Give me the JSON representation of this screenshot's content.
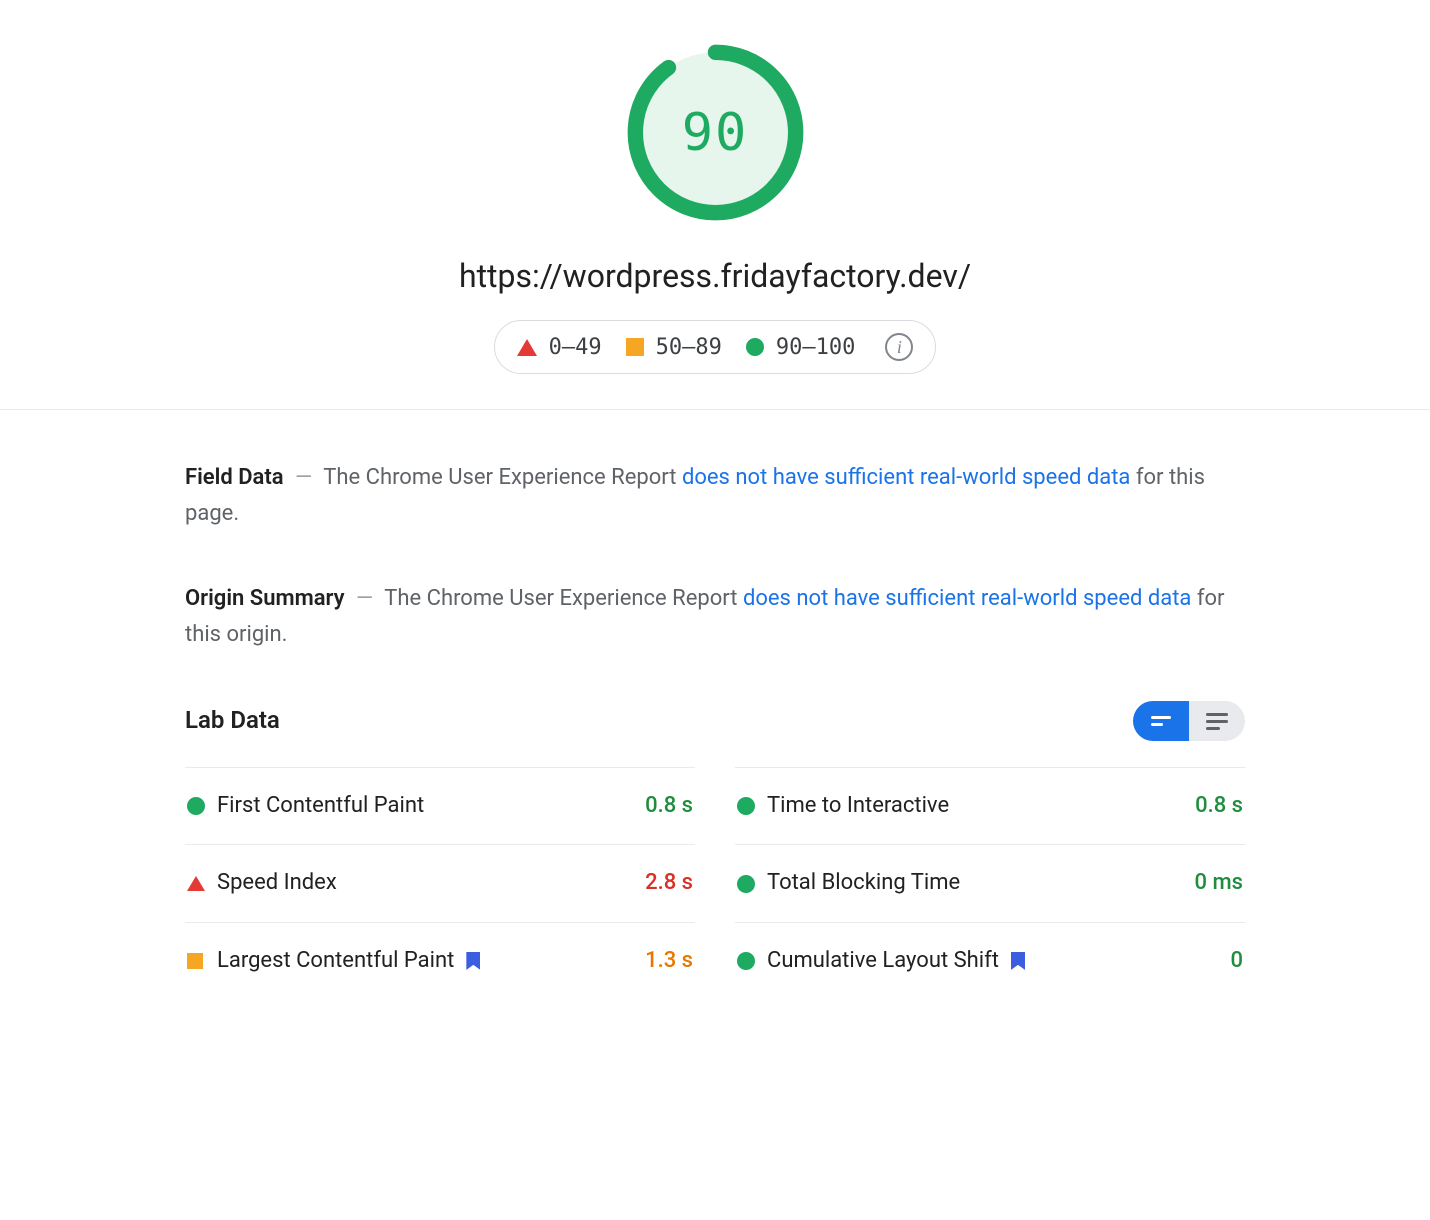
{
  "score": "90",
  "url": "https://wordpress.fridayfactory.dev/",
  "legend": {
    "poor": "0–49",
    "average": "50–89",
    "good": "90–100"
  },
  "field_data": {
    "title": "Field Data",
    "prefix": "The Chrome User Experience Report ",
    "link": "does not have sufficient real-world speed data",
    "suffix": " for this page."
  },
  "origin_summary": {
    "title": "Origin Summary",
    "prefix": "The Chrome User Experience Report ",
    "link": "does not have sufficient real-world speed data",
    "suffix": " for this origin."
  },
  "lab_data": {
    "title": "Lab Data",
    "metrics_left": [
      {
        "label": "First Contentful Paint",
        "value": "0.8 s",
        "status": "good",
        "flag": false
      },
      {
        "label": "Speed Index",
        "value": "2.8 s",
        "status": "poor",
        "flag": false
      },
      {
        "label": "Largest Contentful Paint",
        "value": "1.3 s",
        "status": "average",
        "flag": true
      }
    ],
    "metrics_right": [
      {
        "label": "Time to Interactive",
        "value": "0.8 s",
        "status": "good",
        "flag": false
      },
      {
        "label": "Total Blocking Time",
        "value": "0 ms",
        "status": "good",
        "flag": false
      },
      {
        "label": "Cumulative Layout Shift",
        "value": "0",
        "status": "good",
        "flag": true
      }
    ]
  },
  "colors": {
    "good": "#1eaa60",
    "average": "#f5a623",
    "poor": "#e53935"
  }
}
